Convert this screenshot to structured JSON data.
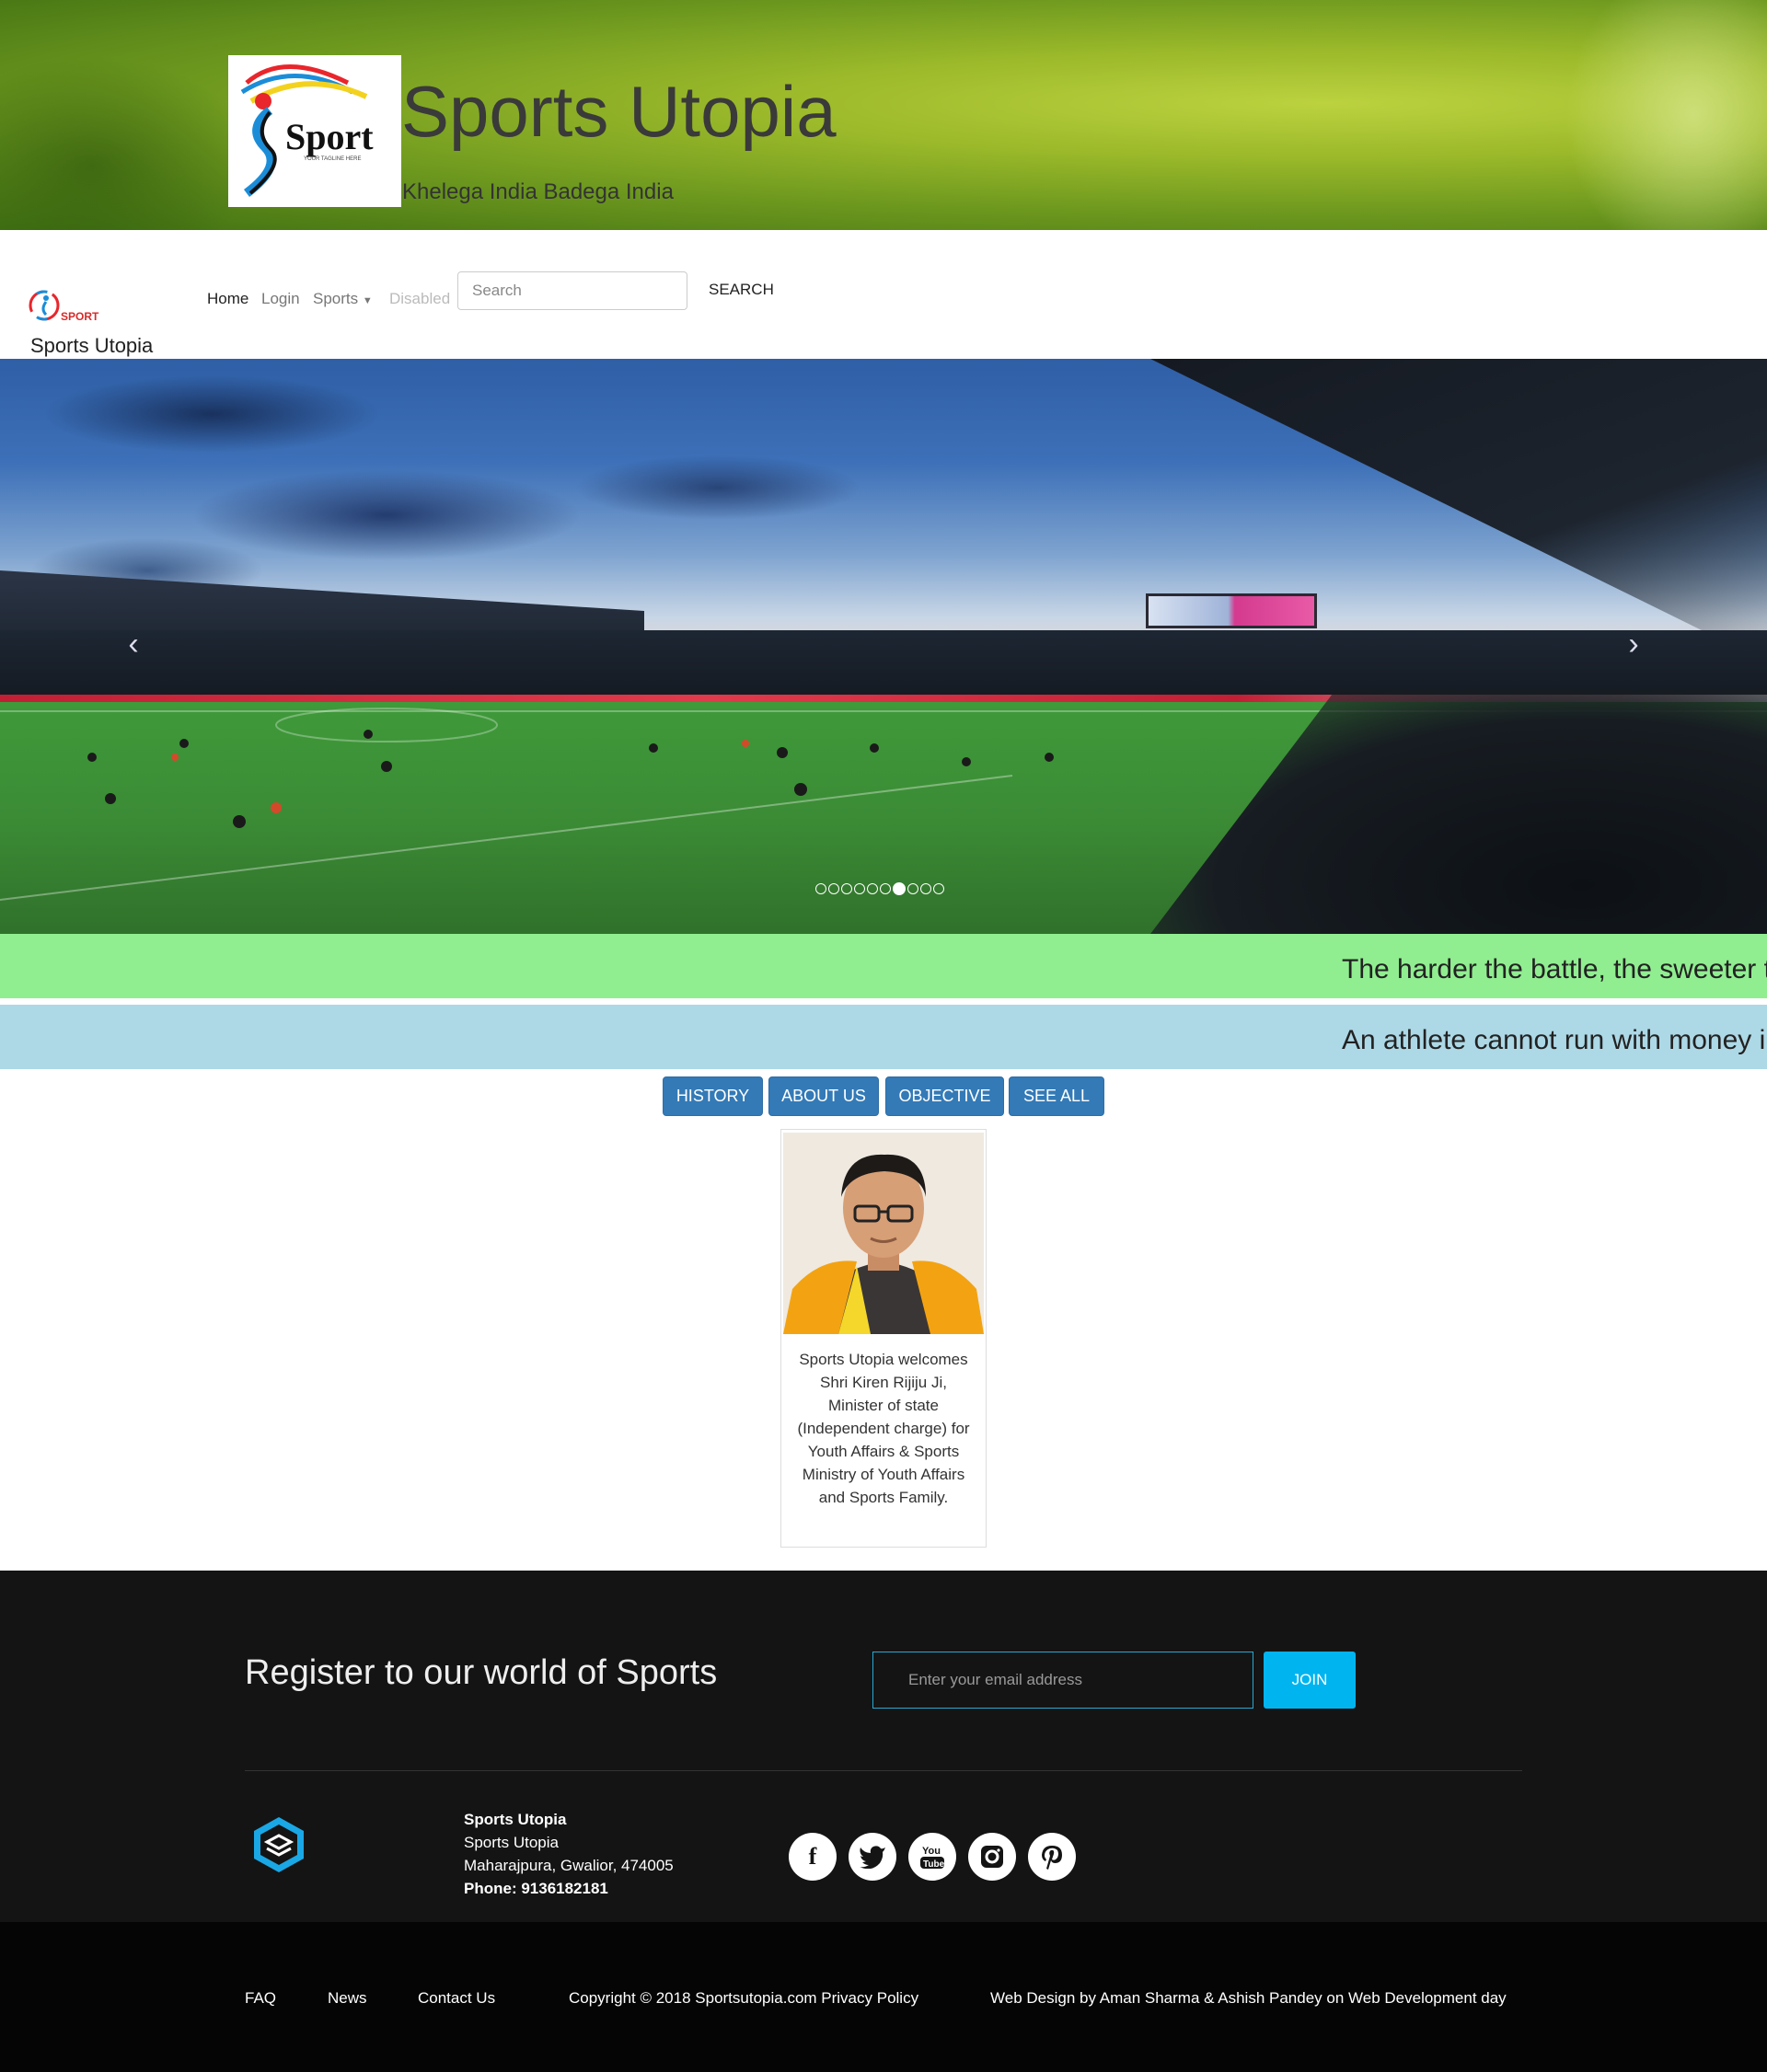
{
  "header": {
    "title": "Sports Utopia",
    "tagline": "Khelega India Badega India",
    "logo_text": "Sport",
    "logo_subtext": "YOUR TAGLINE HERE"
  },
  "navbar": {
    "brand": "Sports Utopia",
    "logo_text": "SPORT",
    "links": [
      "Home",
      "Login",
      "Sports",
      "Disabled"
    ],
    "search_placeholder": "Search",
    "search_button": "SEARCH"
  },
  "carousel": {
    "slide_count": 10,
    "active_index": 6
  },
  "marquees": [
    {
      "text": "The harder the battle, the sweeter t",
      "color": "#90ee90"
    },
    {
      "text": "An athlete cannot run with money i",
      "color": "#add8e6"
    }
  ],
  "tabs": [
    "HISTORY",
    "ABOUT US",
    "OBJECTIVE",
    "SEE ALL"
  ],
  "card": {
    "caption": "Sports Utopia welcomes Shri Kiren Rijiju Ji, Minister of state (Independent charge) for Youth Affairs & Sports Ministry of Youth Affairs and Sports Family."
  },
  "footer": {
    "register_title": "Register to our world of Sports",
    "email_placeholder": "Enter your email address",
    "join_label": "JOIN",
    "address": {
      "name": "Sports Utopia",
      "line1": "Sports Utopia",
      "line2": "Maharajpura, Gwalior, 474005",
      "phone": "Phone: 9136182181"
    },
    "socials": [
      "facebook-icon",
      "twitter-icon",
      "youtube-icon",
      "instagram-icon",
      "pinterest-icon"
    ]
  },
  "bottom": {
    "links": [
      "FAQ",
      "News",
      "Contact Us"
    ],
    "copyright": "Copyright © 2018 Sportsutopia.com Privacy Policy",
    "credit": "Web Design by Aman Sharma & Ashish Pandey on Web Development day"
  },
  "colors": {
    "accent_blue": "#337ab7",
    "join_blue": "#00b4f0",
    "footer_bg": "#141414"
  }
}
